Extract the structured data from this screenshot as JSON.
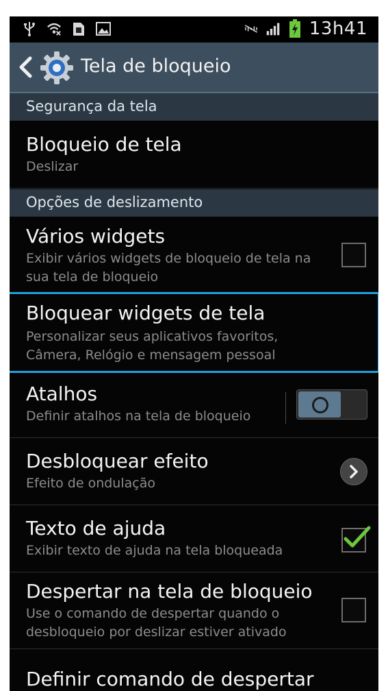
{
  "statusbar": {
    "time": "13h41",
    "icons_left": [
      "usb-icon",
      "wifi-icon",
      "sim-icon",
      "image-icon"
    ],
    "icons_right": [
      "no-signal-icon",
      "signal-icon",
      "battery-charging-icon"
    ]
  },
  "actionbar": {
    "title": "Tela de bloqueio"
  },
  "sections": [
    {
      "label": "Segurança da tela"
    },
    {
      "label": "Opções de deslizamento"
    }
  ],
  "items": [
    {
      "title": "Bloqueio de tela",
      "subtitle": "Deslizar"
    },
    {
      "title": "Vários widgets",
      "subtitle": "Exibir vários widgets de bloqueio de tela na sua tela de bloqueio",
      "checked": false
    },
    {
      "title": "Bloquear widgets de tela",
      "subtitle": "Personalizar seus aplicativos favoritos, Câmera, Relógio e mensagem pessoal"
    },
    {
      "title": "Atalhos",
      "subtitle": "Definir atalhos na tela de bloqueio",
      "toggle": "off"
    },
    {
      "title": "Desbloquear efeito",
      "subtitle": "Efeito de ondulação"
    },
    {
      "title": "Texto de ajuda",
      "subtitle": "Exibir texto de ajuda na tela bloqueada",
      "checked": true
    },
    {
      "title": "Despertar na tela de bloqueio",
      "subtitle": "Use o comando de despertar quando o desbloqueio por deslizar estiver ativado",
      "checked": false
    },
    {
      "title": "Definir comando de despertar",
      "subtitle": ""
    }
  ],
  "colors": {
    "actionbar": "#3d4f5f",
    "section": "#2b3844",
    "highlight": "#1fa2dc",
    "check": "#6cc83c"
  }
}
